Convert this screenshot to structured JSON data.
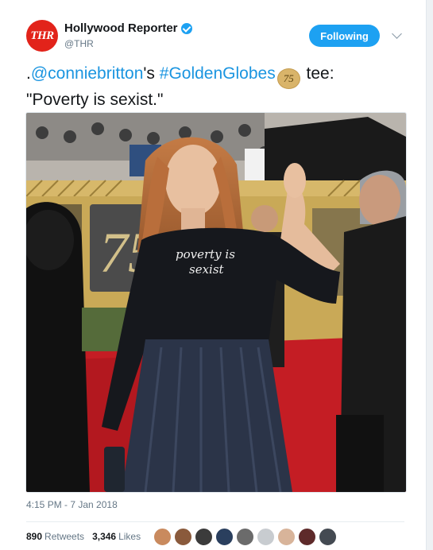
{
  "account": {
    "logo_text": "THR",
    "name": "Hollywood Reporter",
    "handle": "@THR",
    "follow_label": "Following"
  },
  "tweet": {
    "prefix": ".",
    "mention": "@conniebritton",
    "possessive": "'s ",
    "hashtag": "#GoldenGlobes",
    "emoji_text": "75",
    "after_emoji": " tee:",
    "quote": "\"Poverty is sexist.\""
  },
  "photo": {
    "shirt_text_line1": "poverty is",
    "shirt_text_line2": "sexist",
    "backdrop_text": "75"
  },
  "meta": {
    "timestamp": "4:15 PM - 7 Jan 2018"
  },
  "stats": {
    "retweets_count": "890",
    "retweets_label": "Retweets",
    "likes_count": "3,346",
    "likes_label": "Likes"
  },
  "likers": [
    "#c98a5e",
    "#8a5a3c",
    "#3b3b3b",
    "#2a3f5e",
    "#6b6b6b",
    "#c8ccd0",
    "#d8b49a",
    "#5e2a2a",
    "#444a52"
  ]
}
